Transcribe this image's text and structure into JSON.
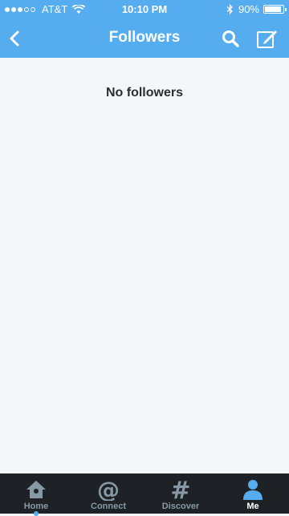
{
  "status_bar": {
    "carrier": "AT&T",
    "time": "10:10 PM",
    "battery_text": "90%",
    "battery_level": 0.9,
    "signal_bars_filled": 3,
    "signal_bars_total": 5
  },
  "nav": {
    "title": "Followers"
  },
  "content": {
    "empty_message": "No followers"
  },
  "tabs": [
    {
      "label": "Home",
      "icon": "home-icon",
      "active": false
    },
    {
      "label": "Connect",
      "icon": "at-icon",
      "active": false
    },
    {
      "label": "Discover",
      "icon": "hashtag-icon",
      "active": false
    },
    {
      "label": "Me",
      "icon": "person-icon",
      "active": true
    }
  ],
  "colors": {
    "brand": "#55acee",
    "tab_bar": "#1e2226",
    "background": "#f4f7fa",
    "tab_inactive": "#8899a6"
  }
}
